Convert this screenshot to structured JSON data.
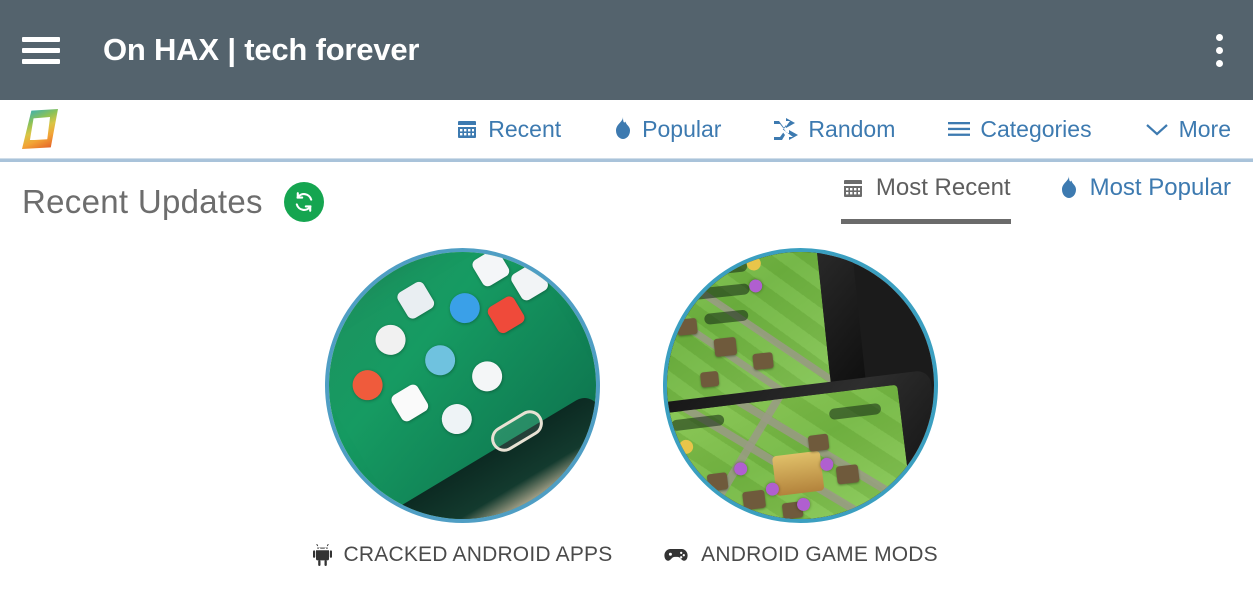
{
  "app_header": {
    "menu_icon": "hamburger-menu-icon",
    "title": "On HAX | tech forever",
    "overflow_icon": "more-vertical-icon",
    "background_color": "#54636d",
    "text_color": "#ffffff"
  },
  "site_nav": {
    "logo_icon": "onhax-logo-icon",
    "link_color": "#3d7ab0",
    "divider_color": "#a9c3da",
    "items": [
      {
        "label": "Recent",
        "icon": "calendar-icon"
      },
      {
        "label": "Popular",
        "icon": "flame-icon"
      },
      {
        "label": "Random",
        "icon": "shuffle-icon"
      },
      {
        "label": "Categories",
        "icon": "list-lines-icon"
      },
      {
        "label": "More",
        "icon": "chevron-down-icon"
      }
    ]
  },
  "main": {
    "section_title": "Recent Updates",
    "refresh": {
      "icon": "refresh-icon",
      "color": "#15a550"
    },
    "sort_tabs": [
      {
        "label": "Most Recent",
        "icon": "calendar-icon",
        "active": true,
        "color": "#5e5e5e"
      },
      {
        "label": "Most Popular",
        "icon": "flame-icon",
        "active": false,
        "color": "#3d7ab0"
      }
    ],
    "categories": [
      {
        "label": "CRACKED ANDROID APPS",
        "icon": "android-robot-icon",
        "thumbnail": "samsung-galaxy-phone-homescreen-photo",
        "ring_color": "#4f9ec4"
      },
      {
        "label": "ANDROID GAME MODS",
        "icon": "gamepad-icon",
        "thumbnail": "clash-of-clans-on-two-devices-photo",
        "ring_color": "#3b9fc0"
      }
    ]
  }
}
